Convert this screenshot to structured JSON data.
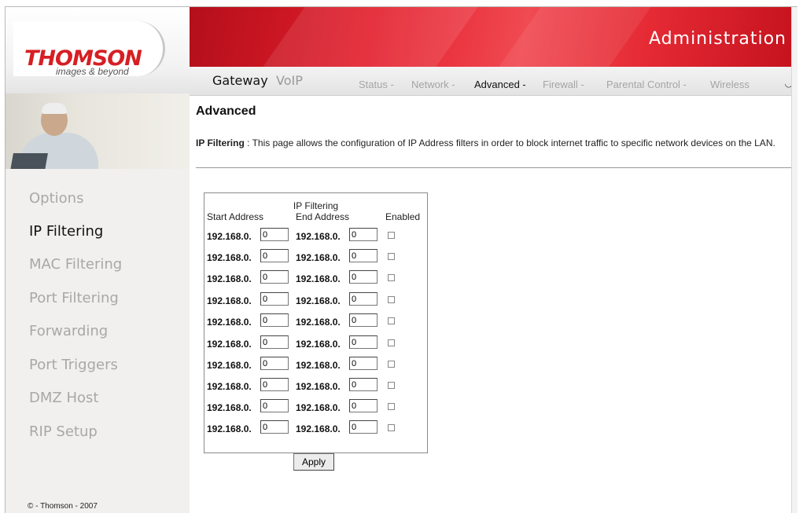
{
  "brand": {
    "name": "THOMSON",
    "tagline": "images & beyond"
  },
  "header": {
    "title": "Administration"
  },
  "tabs": [
    {
      "label": "Gateway",
      "active": true
    },
    {
      "label": "VoIP",
      "active": false
    }
  ],
  "subnav": [
    {
      "label": "Status -",
      "active": false
    },
    {
      "label": "Network -",
      "active": false
    },
    {
      "label": "Advanced -",
      "active": true
    },
    {
      "label": "Firewall -",
      "active": false
    },
    {
      "label": "Parental Control -",
      "active": false
    },
    {
      "label": "Wireless",
      "active": false
    }
  ],
  "sidebar": {
    "items": [
      {
        "label": "Options",
        "active": false
      },
      {
        "label": "IP Filtering",
        "active": true
      },
      {
        "label": "MAC Filtering",
        "active": false
      },
      {
        "label": "Port Filtering",
        "active": false
      },
      {
        "label": "Forwarding",
        "active": false
      },
      {
        "label": "Port Triggers",
        "active": false
      },
      {
        "label": "DMZ Host",
        "active": false
      },
      {
        "label": "RIP Setup",
        "active": false
      }
    ],
    "copyright": "© - Thomson - 2007"
  },
  "page": {
    "title": "Advanced",
    "desc_label": "IP Filtering",
    "desc_text": " :  This page allows the configuration of IP Address filters in order to block internet traffic to specific network devices on the LAN."
  },
  "ip_filter": {
    "caption": "IP Filtering",
    "col_start": "Start Address",
    "col_end": "End Address",
    "col_enabled": "Enabled",
    "prefix": "192.168.0.",
    "rows": [
      {
        "start": "0",
        "end": "0",
        "enabled": false
      },
      {
        "start": "0",
        "end": "0",
        "enabled": false
      },
      {
        "start": "0",
        "end": "0",
        "enabled": false
      },
      {
        "start": "0",
        "end": "0",
        "enabled": false
      },
      {
        "start": "0",
        "end": "0",
        "enabled": false
      },
      {
        "start": "0",
        "end": "0",
        "enabled": false
      },
      {
        "start": "0",
        "end": "0",
        "enabled": false
      },
      {
        "start": "0",
        "end": "0",
        "enabled": false
      },
      {
        "start": "0",
        "end": "0",
        "enabled": false
      },
      {
        "start": "0",
        "end": "0",
        "enabled": false
      }
    ],
    "apply_label": "Apply"
  }
}
